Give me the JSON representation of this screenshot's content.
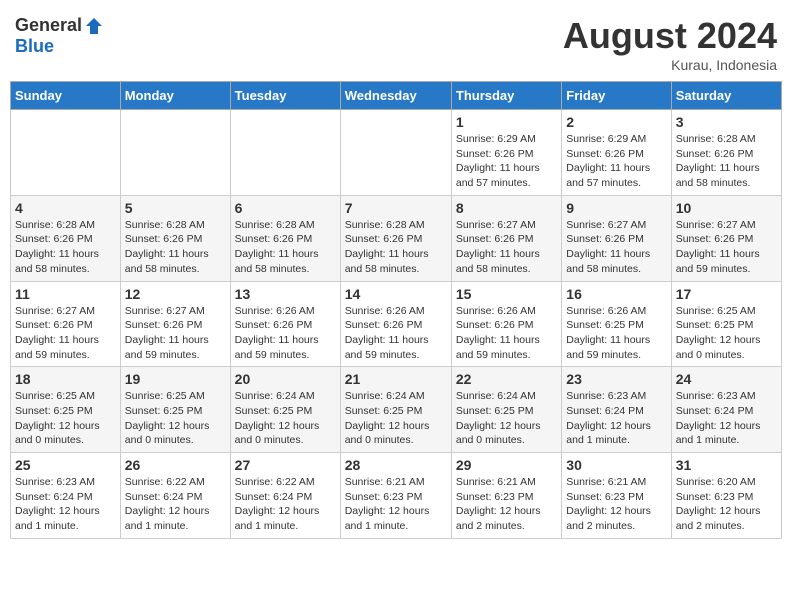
{
  "header": {
    "logo_general": "General",
    "logo_blue": "Blue",
    "month_year": "August 2024",
    "location": "Kurau, Indonesia"
  },
  "days_of_week": [
    "Sunday",
    "Monday",
    "Tuesday",
    "Wednesday",
    "Thursday",
    "Friday",
    "Saturday"
  ],
  "weeks": [
    [
      {
        "day": "",
        "info": ""
      },
      {
        "day": "",
        "info": ""
      },
      {
        "day": "",
        "info": ""
      },
      {
        "day": "",
        "info": ""
      },
      {
        "day": "1",
        "info": "Sunrise: 6:29 AM\nSunset: 6:26 PM\nDaylight: 11 hours\nand 57 minutes."
      },
      {
        "day": "2",
        "info": "Sunrise: 6:29 AM\nSunset: 6:26 PM\nDaylight: 11 hours\nand 57 minutes."
      },
      {
        "day": "3",
        "info": "Sunrise: 6:28 AM\nSunset: 6:26 PM\nDaylight: 11 hours\nand 58 minutes."
      }
    ],
    [
      {
        "day": "4",
        "info": "Sunrise: 6:28 AM\nSunset: 6:26 PM\nDaylight: 11 hours\nand 58 minutes."
      },
      {
        "day": "5",
        "info": "Sunrise: 6:28 AM\nSunset: 6:26 PM\nDaylight: 11 hours\nand 58 minutes."
      },
      {
        "day": "6",
        "info": "Sunrise: 6:28 AM\nSunset: 6:26 PM\nDaylight: 11 hours\nand 58 minutes."
      },
      {
        "day": "7",
        "info": "Sunrise: 6:28 AM\nSunset: 6:26 PM\nDaylight: 11 hours\nand 58 minutes."
      },
      {
        "day": "8",
        "info": "Sunrise: 6:27 AM\nSunset: 6:26 PM\nDaylight: 11 hours\nand 58 minutes."
      },
      {
        "day": "9",
        "info": "Sunrise: 6:27 AM\nSunset: 6:26 PM\nDaylight: 11 hours\nand 58 minutes."
      },
      {
        "day": "10",
        "info": "Sunrise: 6:27 AM\nSunset: 6:26 PM\nDaylight: 11 hours\nand 59 minutes."
      }
    ],
    [
      {
        "day": "11",
        "info": "Sunrise: 6:27 AM\nSunset: 6:26 PM\nDaylight: 11 hours\nand 59 minutes."
      },
      {
        "day": "12",
        "info": "Sunrise: 6:27 AM\nSunset: 6:26 PM\nDaylight: 11 hours\nand 59 minutes."
      },
      {
        "day": "13",
        "info": "Sunrise: 6:26 AM\nSunset: 6:26 PM\nDaylight: 11 hours\nand 59 minutes."
      },
      {
        "day": "14",
        "info": "Sunrise: 6:26 AM\nSunset: 6:26 PM\nDaylight: 11 hours\nand 59 minutes."
      },
      {
        "day": "15",
        "info": "Sunrise: 6:26 AM\nSunset: 6:26 PM\nDaylight: 11 hours\nand 59 minutes."
      },
      {
        "day": "16",
        "info": "Sunrise: 6:26 AM\nSunset: 6:25 PM\nDaylight: 11 hours\nand 59 minutes."
      },
      {
        "day": "17",
        "info": "Sunrise: 6:25 AM\nSunset: 6:25 PM\nDaylight: 12 hours\nand 0 minutes."
      }
    ],
    [
      {
        "day": "18",
        "info": "Sunrise: 6:25 AM\nSunset: 6:25 PM\nDaylight: 12 hours\nand 0 minutes."
      },
      {
        "day": "19",
        "info": "Sunrise: 6:25 AM\nSunset: 6:25 PM\nDaylight: 12 hours\nand 0 minutes."
      },
      {
        "day": "20",
        "info": "Sunrise: 6:24 AM\nSunset: 6:25 PM\nDaylight: 12 hours\nand 0 minutes."
      },
      {
        "day": "21",
        "info": "Sunrise: 6:24 AM\nSunset: 6:25 PM\nDaylight: 12 hours\nand 0 minutes."
      },
      {
        "day": "22",
        "info": "Sunrise: 6:24 AM\nSunset: 6:25 PM\nDaylight: 12 hours\nand 0 minutes."
      },
      {
        "day": "23",
        "info": "Sunrise: 6:23 AM\nSunset: 6:24 PM\nDaylight: 12 hours\nand 1 minute."
      },
      {
        "day": "24",
        "info": "Sunrise: 6:23 AM\nSunset: 6:24 PM\nDaylight: 12 hours\nand 1 minute."
      }
    ],
    [
      {
        "day": "25",
        "info": "Sunrise: 6:23 AM\nSunset: 6:24 PM\nDaylight: 12 hours\nand 1 minute."
      },
      {
        "day": "26",
        "info": "Sunrise: 6:22 AM\nSunset: 6:24 PM\nDaylight: 12 hours\nand 1 minute."
      },
      {
        "day": "27",
        "info": "Sunrise: 6:22 AM\nSunset: 6:24 PM\nDaylight: 12 hours\nand 1 minute."
      },
      {
        "day": "28",
        "info": "Sunrise: 6:21 AM\nSunset: 6:23 PM\nDaylight: 12 hours\nand 1 minute."
      },
      {
        "day": "29",
        "info": "Sunrise: 6:21 AM\nSunset: 6:23 PM\nDaylight: 12 hours\nand 2 minutes."
      },
      {
        "day": "30",
        "info": "Sunrise: 6:21 AM\nSunset: 6:23 PM\nDaylight: 12 hours\nand 2 minutes."
      },
      {
        "day": "31",
        "info": "Sunrise: 6:20 AM\nSunset: 6:23 PM\nDaylight: 12 hours\nand 2 minutes."
      }
    ]
  ]
}
